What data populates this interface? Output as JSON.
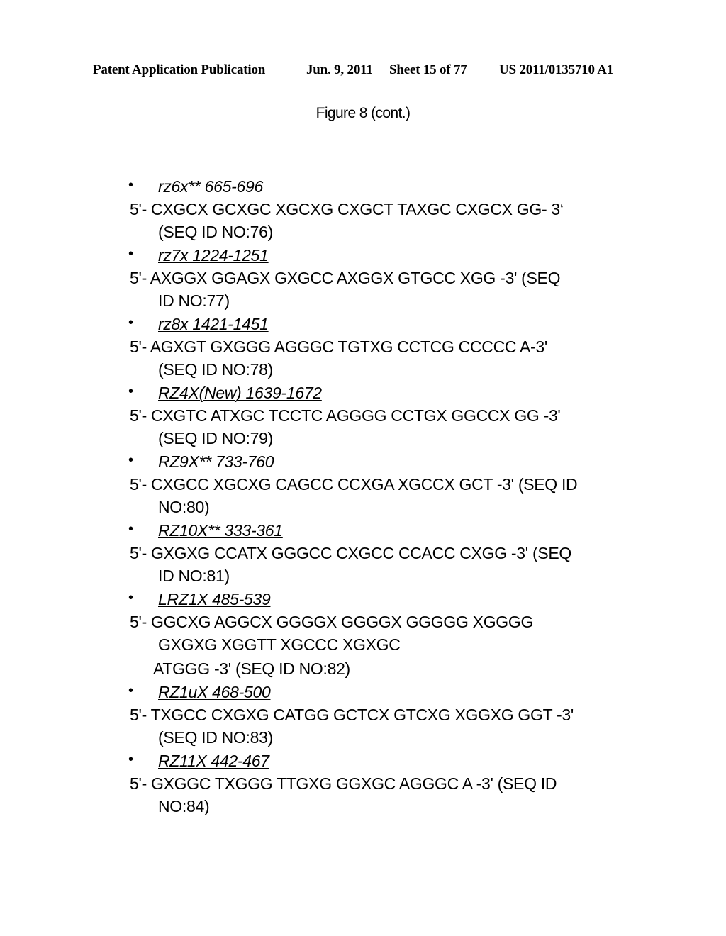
{
  "header": {
    "publication": "Patent Application Publication",
    "date": "Jun. 9, 2011",
    "sheet": "Sheet 15 of 77",
    "number": "US 2011/0135710 A1"
  },
  "figure": {
    "title": "Figure 8 (cont.)"
  },
  "entries": [
    {
      "bullet": "•",
      "label": "rz6x** 665-696",
      "lines": [
        "5'- CXGCX GCXGC XGCXG CXGCT TAXGC CXGCX GG- 3‘",
        "(SEQ ID NO:76)"
      ]
    },
    {
      "bullet": "•",
      "label": "rz7x 1224-1251",
      "lines": [
        "5'- AXGGX GGAGX GXGCC AXGGX GTGCC XGG -3' (SEQ",
        "ID NO:77)"
      ]
    },
    {
      "bullet": "•",
      "label": "rz8x 1421-1451",
      "lines": [
        "5'- AGXGT GXGGG AGGGC TGTXG CCTCG CCCCC A-3'",
        "(SEQ ID NO:78)"
      ]
    },
    {
      "bullet": "•",
      "label": "RZ4X(New) 1639-1672",
      "lines": [
        "5'- CXGTC ATXGC TCCTC AGGGG CCTGX GGCCX GG -3'",
        "(SEQ ID NO:79)"
      ]
    },
    {
      "bullet": "•",
      "label": "RZ9X** 733-760",
      "lines": [
        "5'- CXGCC XGCXG CAGCC CCXGA XGCCX GCT -3' (SEQ ID",
        "NO:80)"
      ]
    },
    {
      "bullet": "•",
      "label": "RZ10X** 333-361",
      "lines": [
        "5'- GXGXG CCATX GGGCC CXGCC CCACC CXGG -3' (SEQ",
        "ID NO:81)"
      ]
    },
    {
      "bullet": "•",
      "label": "LRZ1X 485-539",
      "lines": [
        "5'- GGCXG AGGCX GGGGX GGGGX GGGGG XGGGG",
        "GXGXG XGGTT XGCCC XGXGC",
        "ATGGG -3' (SEQ ID NO:82)"
      ]
    },
    {
      "bullet": "•",
      "label": "RZ1uX 468-500",
      "lines": [
        "5'- TXGCC CXGXG CATGG GCTCX GTCXG XGGXG GGT -3'",
        "(SEQ ID NO:83)"
      ]
    },
    {
      "bullet": "•",
      "label": "RZ11X 442-467",
      "lines": [
        "5'- GXGGC TXGGG TTGXG GGXGC AGGGC A -3' (SEQ ID",
        "NO:84)"
      ]
    }
  ]
}
